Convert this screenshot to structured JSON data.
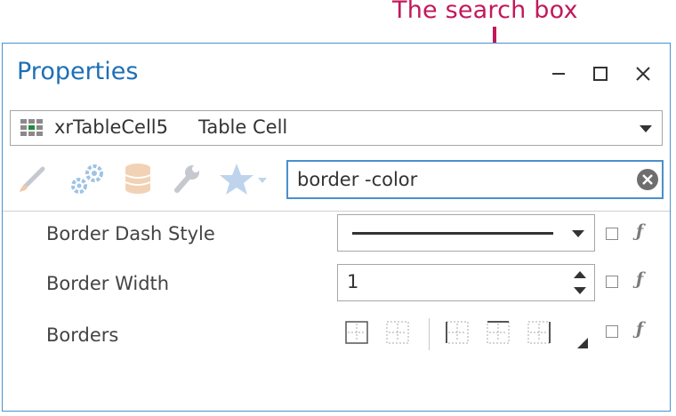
{
  "annotation": {
    "label": "The search box",
    "color": "#c2185b"
  },
  "panel": {
    "title": "Properties",
    "window_controls": [
      "minimize-icon",
      "maximize-icon",
      "close-icon"
    ]
  },
  "selector": {
    "object_name": "xrTableCell5",
    "object_type": "Table Cell"
  },
  "toolbar": {
    "icons": [
      "appearance-brush-icon",
      "behavior-gears-icon",
      "data-database-icon",
      "design-wrench-icon",
      "favorites-star-icon"
    ]
  },
  "search": {
    "value": "border -color"
  },
  "properties": [
    {
      "label": "Border Dash Style",
      "editor": "dash-combo",
      "value": "solid line"
    },
    {
      "label": "Border Width",
      "editor": "spin",
      "value": "1"
    },
    {
      "label": "Borders",
      "editor": "border-buttons"
    }
  ],
  "colors": {
    "accent": "#1e6fb5",
    "focus_border": "#4a90cc",
    "annotation": "#c2185b"
  }
}
